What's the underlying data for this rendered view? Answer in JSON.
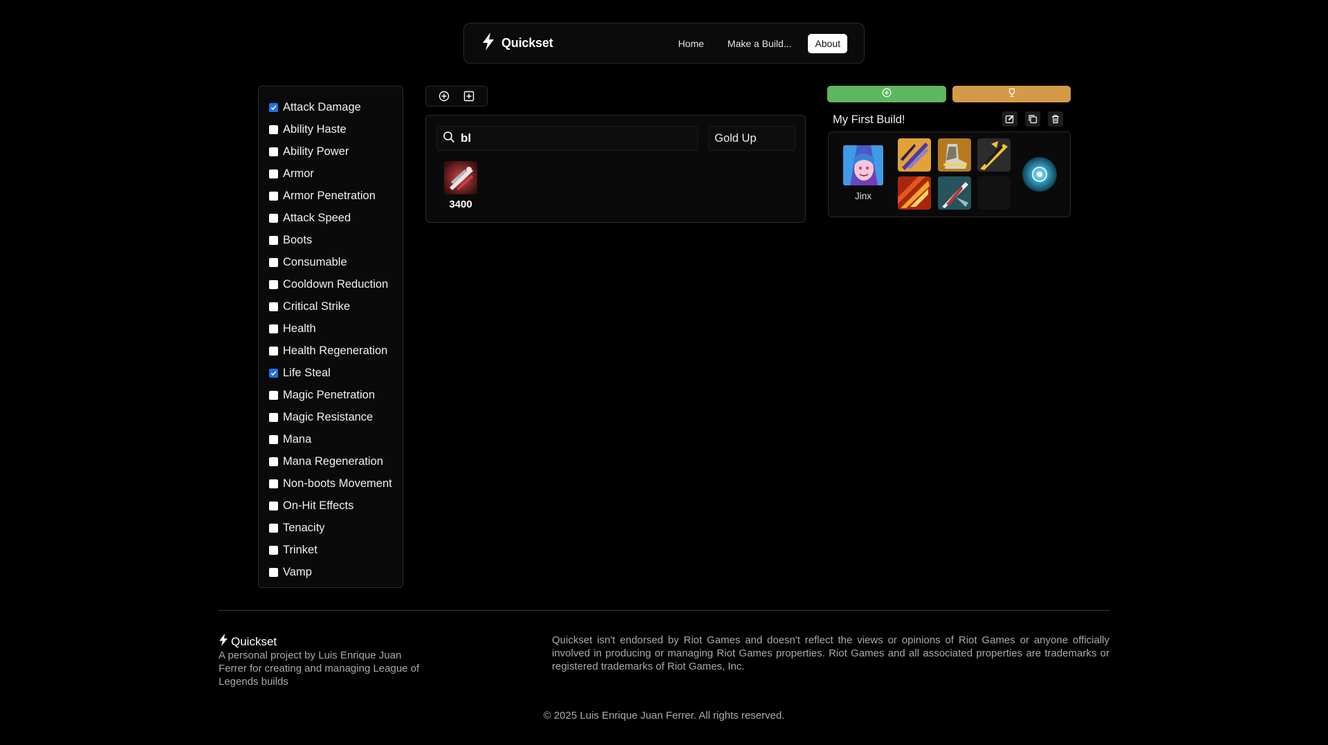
{
  "nav": {
    "brand": "Quickset",
    "links": [
      {
        "label": "Home",
        "active": false
      },
      {
        "label": "Make a Build...",
        "active": false
      },
      {
        "label": "About",
        "active": true
      }
    ]
  },
  "filters": {
    "items": [
      {
        "label": "Attack Damage",
        "checked": true
      },
      {
        "label": "Ability Haste",
        "checked": false
      },
      {
        "label": "Ability Power",
        "checked": false
      },
      {
        "label": "Armor",
        "checked": false
      },
      {
        "label": "Armor Penetration",
        "checked": false
      },
      {
        "label": "Attack Speed",
        "checked": false
      },
      {
        "label": "Boots",
        "checked": false
      },
      {
        "label": "Consumable",
        "checked": false
      },
      {
        "label": "Cooldown Reduction",
        "checked": false
      },
      {
        "label": "Critical Strike",
        "checked": false
      },
      {
        "label": "Health",
        "checked": false
      },
      {
        "label": "Health Regeneration",
        "checked": false
      },
      {
        "label": "Life Steal",
        "checked": true
      },
      {
        "label": "Magic Penetration",
        "checked": false
      },
      {
        "label": "Magic Resistance",
        "checked": false
      },
      {
        "label": "Mana",
        "checked": false
      },
      {
        "label": "Mana Regeneration",
        "checked": false
      },
      {
        "label": "Non-boots Movement",
        "checked": false
      },
      {
        "label": "On-Hit Effects",
        "checked": false
      },
      {
        "label": "Tenacity",
        "checked": false
      },
      {
        "label": "Trinket",
        "checked": false
      },
      {
        "label": "Vamp",
        "checked": false
      }
    ]
  },
  "toolbar": {
    "icons": [
      "circle-plus-icon",
      "square-plus-icon"
    ]
  },
  "search": {
    "value": "bl",
    "sort_value": "Gold Up"
  },
  "results": [
    {
      "price": "3400",
      "icon": "item-icon"
    }
  ],
  "build": {
    "new_icon": "circle-plus-icon",
    "save_icon": "trophy-icon",
    "title": "My First Build!",
    "action_icons": [
      "edit-icon",
      "copy-icon",
      "trash-icon"
    ],
    "champion": "Jinx",
    "item_slots": 6,
    "empty_slots": 1
  },
  "colors": {
    "new_button": "#5cb85c",
    "save_button": "#d49a48",
    "checkbox_checked": "#1a73e8"
  },
  "footer": {
    "brand": "Quickset",
    "description": "A personal project by Luis Enrique Juan Ferrer for creating and managing League of Legends builds",
    "legal": "Quickset isn't endorsed by Riot Games and doesn't reflect the views or opinions of Riot Games or anyone officially involved in producing or managing Riot Games properties. Riot Games and all associated properties are trademarks or registered trademarks of Riot Games, Inc.",
    "copyright": "© 2025 Luis Enrique Juan Ferrer. All rights reserved."
  }
}
